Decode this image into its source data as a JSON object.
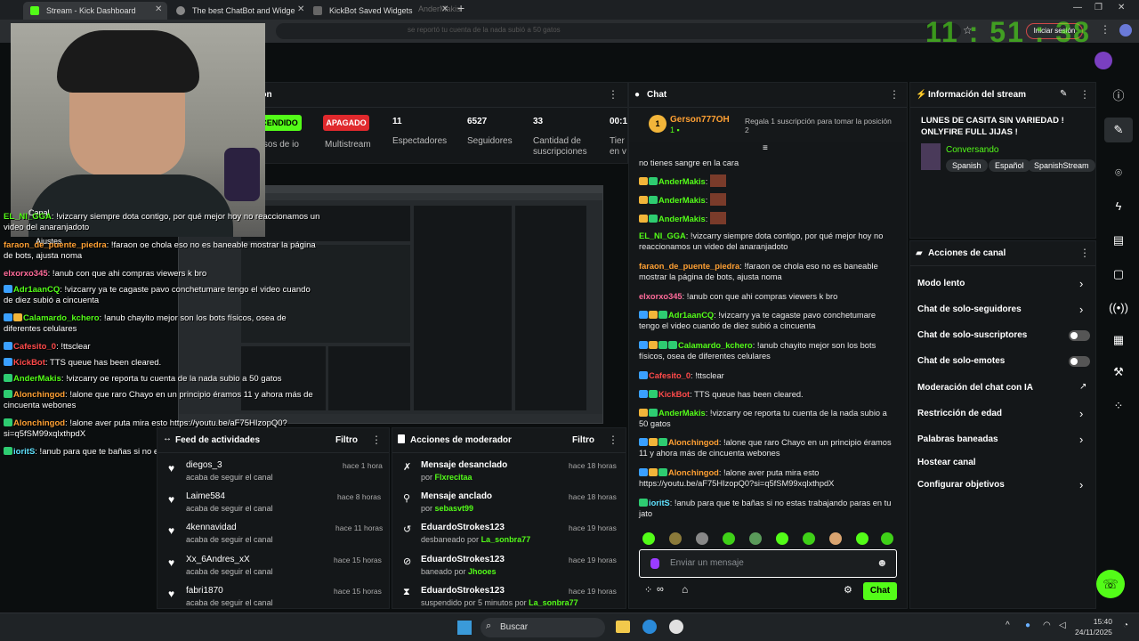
{
  "browser": {
    "tabs": [
      {
        "label": "Stream - Kick Dashboard",
        "color": "#53fc18"
      },
      {
        "label": "The best ChatBot and Widge",
        "color": "#aaaaaa"
      },
      {
        "label": "KickBot Saved Widgets",
        "color": "#aaaaaa"
      },
      {
        "label": "AnderMakis",
        "color": "#aaaaaa"
      }
    ],
    "notice": "se reportó tu cuenta de la nada subió a 50 gatos",
    "login_button": "Iniciar sesión",
    "clock_overlay": "11 : 51 : 38"
  },
  "stats": {
    "panel_title": "ción",
    "live_badge": "CENDIDO",
    "multistream_badge": "APAGADO",
    "items": [
      {
        "value": "",
        "label": "resos de io"
      },
      {
        "value": "",
        "label": "Multistream"
      },
      {
        "value": "11",
        "label": "Espectadores"
      },
      {
        "value": "6527",
        "label": "Seguidores"
      },
      {
        "value": "33",
        "label": "Cantidad de suscripciones"
      },
      {
        "value": "00:1",
        "label": "Tier en v"
      }
    ]
  },
  "overlay_chat": [
    {
      "user": "EL_NI_GGA",
      "text": ": !vizcarry siempre dota contigo, por qué mejor hoy no reaccionamos un video del anaranjadoto",
      "color": "#53fc18"
    },
    {
      "user": "faraon_de_puente_piedra",
      "text": ": !faraon oe chola eso no es baneable mostrar la página de bots, ajusta noma",
      "color": "#ffa033"
    },
    {
      "user": "elxorxo345",
      "text": ": !anub con que ahi compras viewers k bro",
      "color": "#ff6b9a"
    },
    {
      "user": "Adr1aanCQ",
      "text": ": !vizcarry ya te cagaste pavo conchetumare tengo el video cuando de diez subió a cincuenta",
      "color": "#53fc18"
    },
    {
      "user": "Calamardo_kchero",
      "text": ": !anub chayito mejor son los bots físicos, osea de diferentes celulares",
      "color": "#53fc18"
    },
    {
      "user": "Cafesito_0",
      "text": ": !ttsclear",
      "color": "#ff4a4a"
    },
    {
      "user": "KickBot",
      "text": ": TTS queue has been cleared.",
      "color": "#ff4a4a"
    },
    {
      "user": "AnderMakis",
      "text": ": !vizcarry oe reporta tu cuenta de la nada subio a 50 gatos",
      "color": "#53fc18"
    },
    {
      "user": "Alonchingod",
      "text": ": !alone que raro Chayo en un principio éramos 11 y ahora más de cincuenta webones",
      "color": "#ffa033"
    },
    {
      "user": "Alonchingod",
      "text": ": !alone aver puta mira esto https://youtu.be/aF75HIzopQ0?si=q5fSM99xqlxthpdX",
      "color": "#ffa033"
    },
    {
      "user": "ioritS",
      "text": ": !anub para que te bañas si no estas trabajando paras en tu jato",
      "color": "#5fe3ff"
    }
  ],
  "overlay_labels": {
    "canal": "Canal",
    "ajustes": "Ajustes"
  },
  "chat": {
    "title": "Chat",
    "pinned_user": "Gerson777OH",
    "pinned_count": "1",
    "pinned_gift": "Regala 1 suscripción para tomar la posición 2",
    "top_fragment": "no tienes sangre en la cara",
    "emote_users": [
      "AnderMakis",
      "AnderMakis",
      "AnderMakis"
    ],
    "messages": [
      {
        "user": "EL_NI_GGA",
        "text": ": !vizcarry siempre dota contigo, por qué mejor hoy no reaccionamos un video del anaranjadoto",
        "color": "#53fc18"
      },
      {
        "user": "faraon_de_puente_piedra",
        "text": ": !faraon oe chola eso no es baneable mostrar la página de bots, ajusta noma",
        "color": "#ffa033"
      },
      {
        "user": "elxorxo345",
        "text": ": !anub con que ahi compras viewers k bro",
        "color": "#ff6b9a"
      },
      {
        "user": "Adr1aanCQ",
        "text": ": !vizcarry ya te cagaste pavo conchetumare tengo el video cuando de diez subió a cincuenta",
        "color": "#53fc18"
      },
      {
        "user": "Calamardo_kchero",
        "text": ": !anub chayito mejor son los bots físicos, osea de diferentes celulares",
        "color": "#53fc18"
      },
      {
        "user": "Cafesito_0",
        "text": ": !ttsclear",
        "color": "#ff4a4a"
      },
      {
        "user": "KickBot",
        "text": ": TTS queue has been cleared.",
        "color": "#ff4a4a"
      },
      {
        "user": "AnderMakis",
        "text": ": !vizcarry oe reporta tu cuenta de la nada subio a 50 gatos",
        "color": "#53fc18"
      },
      {
        "user": "Alonchingod",
        "text": ": !alone que raro Chayo en un principio éramos 11 y ahora más de cincuenta webones",
        "color": "#ffa033"
      },
      {
        "user": "Alonchingod",
        "text": ": !alone aver puta mira esto https://youtu.be/aF75HIzopQ0?si=q5fSM99xqlxthpdX",
        "color": "#ffa033"
      },
      {
        "user": "ioritS",
        "text": ": !anub para que te bañas si no estas trabajando paras en tu jato",
        "color": "#5fe3ff"
      }
    ],
    "input_placeholder": "Enviar un mensaje",
    "send_label": "Chat"
  },
  "stream_info": {
    "title_label": "Información del stream",
    "stream_title": "LUNES DE CASITA SIN VARIEDAD ! ONLYFIRE FULL JIJAS !",
    "category": "Conversando",
    "tags": [
      "Spanish",
      "Español",
      "SpanishStream"
    ]
  },
  "channel_actions": {
    "title": "Acciones de canal",
    "items": [
      {
        "label": "Modo lento",
        "control": "chevron"
      },
      {
        "label": "Chat de solo-seguidores",
        "control": "chevron"
      },
      {
        "label": "Chat de solo-suscriptores",
        "control": "toggle"
      },
      {
        "label": "Chat de solo-emotes",
        "control": "toggle"
      },
      {
        "label": "Moderación del chat con IA",
        "control": "external"
      },
      {
        "label": "Restricción de edad",
        "control": "chevron"
      },
      {
        "label": "Palabras baneadas",
        "control": "chevron"
      },
      {
        "label": "Hostear canal",
        "control": "none"
      },
      {
        "label": "Configurar objetivos",
        "control": "chevron"
      }
    ]
  },
  "activity_feed": {
    "title": "Feed de actividades",
    "filter": "Filtro",
    "items": [
      {
        "name": "diegos_3",
        "sub": "acaba de seguir el canal",
        "time": "hace 1 hora"
      },
      {
        "name": "Laime584",
        "sub": "acaba de seguir el canal",
        "time": "hace 8 horas"
      },
      {
        "name": "4kennavidad",
        "sub": "acaba de seguir el canal",
        "time": "hace 11 horas"
      },
      {
        "name": "Xx_6Andres_xX",
        "sub": "acaba de seguir el canal",
        "time": "hace 15 horas"
      },
      {
        "name": "fabri1870",
        "sub": "acaba de seguir el canal",
        "time": "hace 15 horas"
      }
    ]
  },
  "mod_actions": {
    "title": "Acciones de moderador",
    "filter": "Filtro",
    "items": [
      {
        "title": "Mensaje desanclado",
        "by_prefix": "por ",
        "by": "Flxrecitaa",
        "time": "hace 18 horas"
      },
      {
        "title": "Mensaje anclado",
        "by_prefix": "por ",
        "by": "sebasvt99",
        "time": "hace 18 horas"
      },
      {
        "title": "EduardoStrokes123",
        "by_prefix": "desbaneado por ",
        "by": "La_sonbra77",
        "time": "hace 19 horas"
      },
      {
        "title": "EduardoStrokes123",
        "by_prefix": "baneado por ",
        "by": "Jhooes",
        "time": "hace 19 horas"
      },
      {
        "title": "EduardoStrokes123",
        "by_prefix": "suspendido por 5 minutos por ",
        "by": "La_sonbra77",
        "time": "hace 19 horas"
      }
    ]
  },
  "taskbar": {
    "search": "Buscar",
    "time": "15:40",
    "date": "24/11/2025"
  },
  "colors": {
    "accent": "#53fc18",
    "danger": "#e0292d",
    "bg": "#0b0e0f",
    "panel": "#141719"
  }
}
